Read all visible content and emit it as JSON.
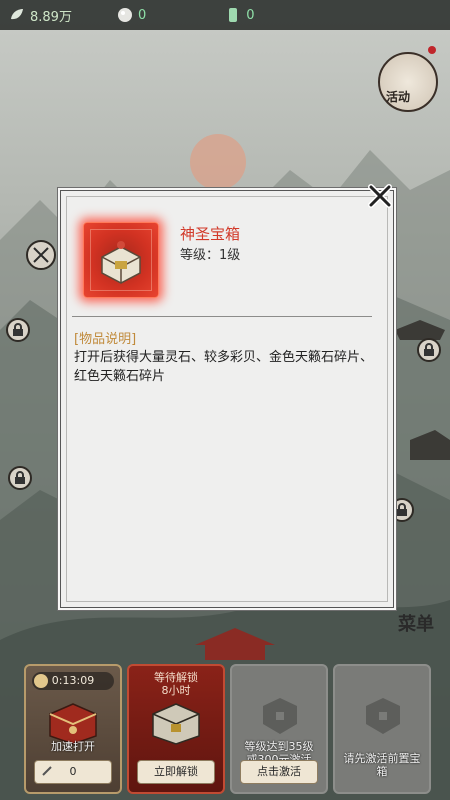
{
  "resources": [
    {
      "icon": "silver-leaf-icon",
      "value": "8.89万"
    },
    {
      "icon": "pearl-icon",
      "value": "0"
    },
    {
      "icon": "jade-scroll-icon",
      "value": "0"
    }
  ],
  "event_badge": {
    "label": "活动"
  },
  "menu_badge": {
    "label": "菜单"
  },
  "modal": {
    "item_name": "神圣宝箱",
    "item_level": "等级：1级",
    "section_title": "[物品说明]",
    "description": "打开后获得大量灵石、较多彩贝、金色天籁石碎片、红色天籁石碎片"
  },
  "slots": [
    {
      "timer": "0:13:09",
      "caption": "加速打开",
      "button": "0"
    },
    {
      "wait_label": "等待解锁\n8小时",
      "button": "立即解锁"
    },
    {
      "caption": "等级达到35级或300元激活",
      "button": "点击激活"
    },
    {
      "button": "请先激活前置宝箱"
    }
  ]
}
